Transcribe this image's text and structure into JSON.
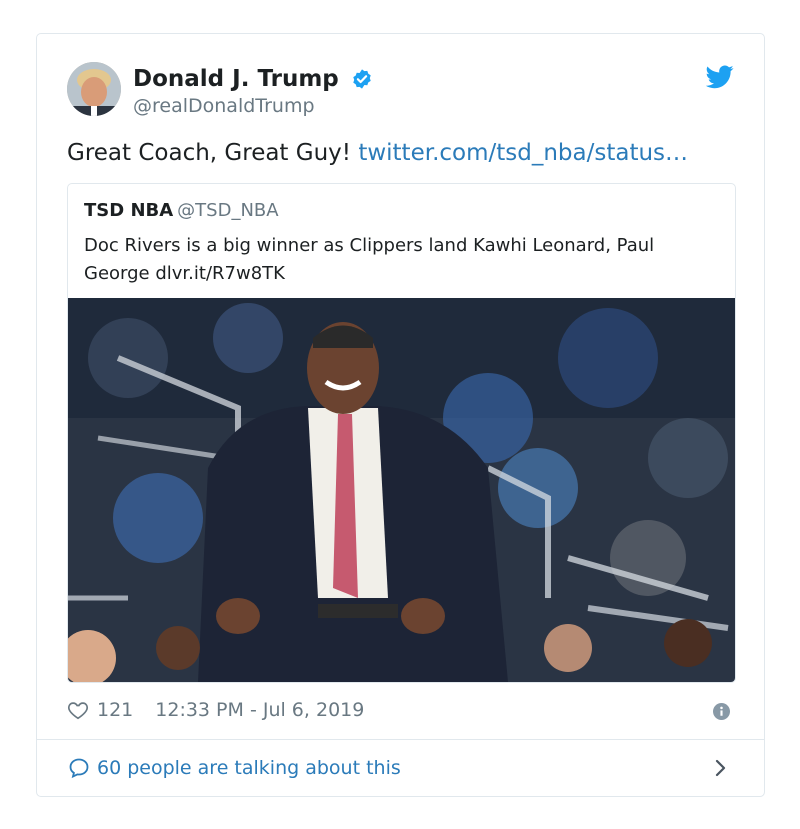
{
  "author": {
    "name": "Donald J. Trump",
    "handle": "@realDonaldTrump"
  },
  "tweet": {
    "text": "Great Coach, Great Guy! ",
    "link": "twitter.com/tsd_nba/status…"
  },
  "quoted_tweet": {
    "name": "TSD NBA",
    "handle": "@TSD_NBA",
    "text": "Doc Rivers is a big winner as Clippers land Kawhi Leonard, Paul George dlvr.it/R7w8TK"
  },
  "stats": {
    "likes": "121",
    "timestamp": "12:33 PM - Jul 6, 2019"
  },
  "footer": {
    "talking": "60 people are talking about this"
  },
  "icons": {
    "verified": "verified-badge-icon",
    "brand": "twitter-bird-icon",
    "like": "heart-icon",
    "info": "info-icon",
    "reply": "speech-bubble-icon",
    "chevron": "chevron-right-icon"
  },
  "colors": {
    "link": "#2b7bb9",
    "brand": "#1da1f2",
    "muted": "#697882",
    "border": "#e1e8ed"
  }
}
